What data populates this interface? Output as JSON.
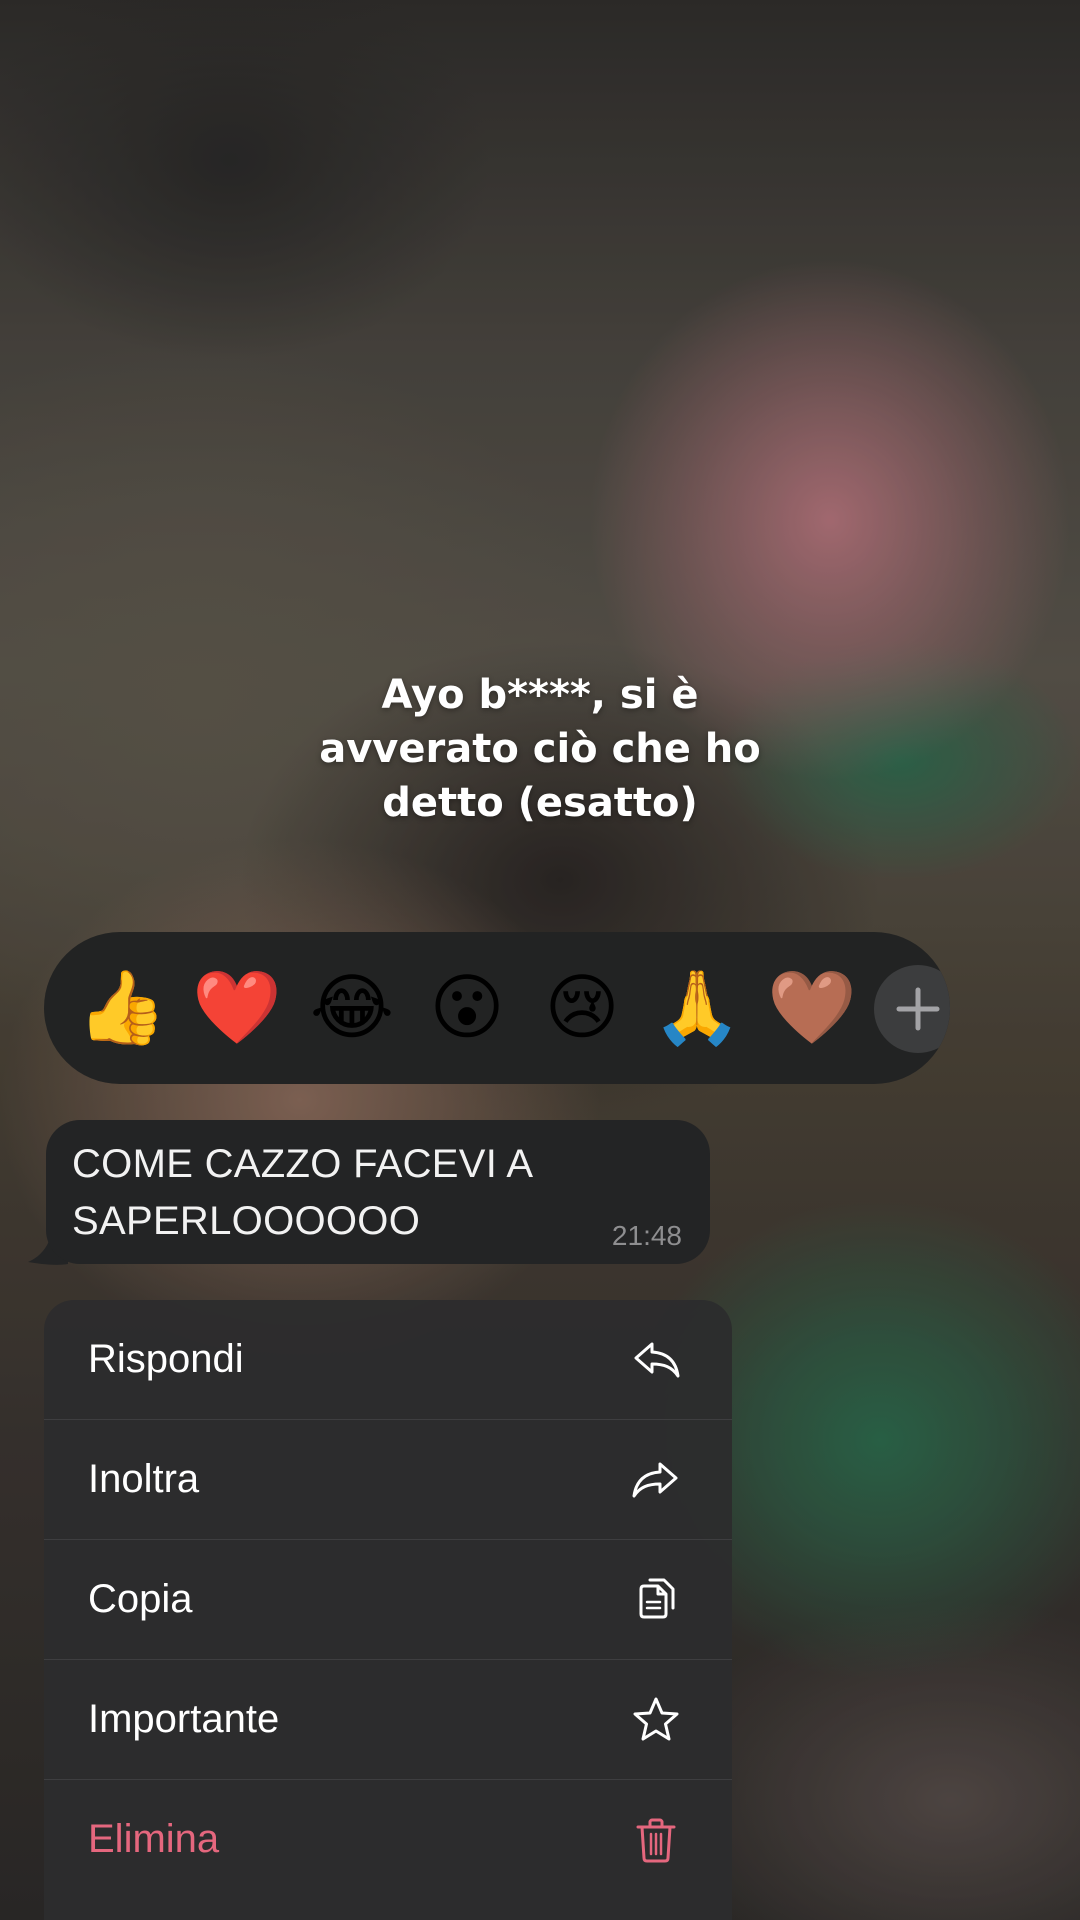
{
  "story": {
    "caption_lines": [
      "Ayo b****, si è",
      "avverato ciò che ho",
      "detto (esatto)"
    ]
  },
  "reactions": {
    "emojis": [
      "👍",
      "❤️",
      "😂",
      "😮",
      "😢",
      "🙏",
      "🤎"
    ],
    "add_icon": "plus-icon"
  },
  "message": {
    "text_line1": "COME CAZZO FACEVI A",
    "text_line2": "SAPERLOOOOOO",
    "time": "21:48"
  },
  "menu": {
    "items": [
      {
        "label": "Rispondi",
        "icon": "reply-icon"
      },
      {
        "label": "Inoltra",
        "icon": "forward-icon"
      },
      {
        "label": "Copia",
        "icon": "copy-icon"
      },
      {
        "label": "Importante",
        "icon": "star-icon"
      },
      {
        "label": "Elimina",
        "icon": "trash-icon",
        "color": "#e5677e"
      }
    ]
  },
  "colors": {
    "destructive": "#e5677e",
    "menu_bg": "#2c2c2d",
    "bubble_bg": "#232425"
  }
}
